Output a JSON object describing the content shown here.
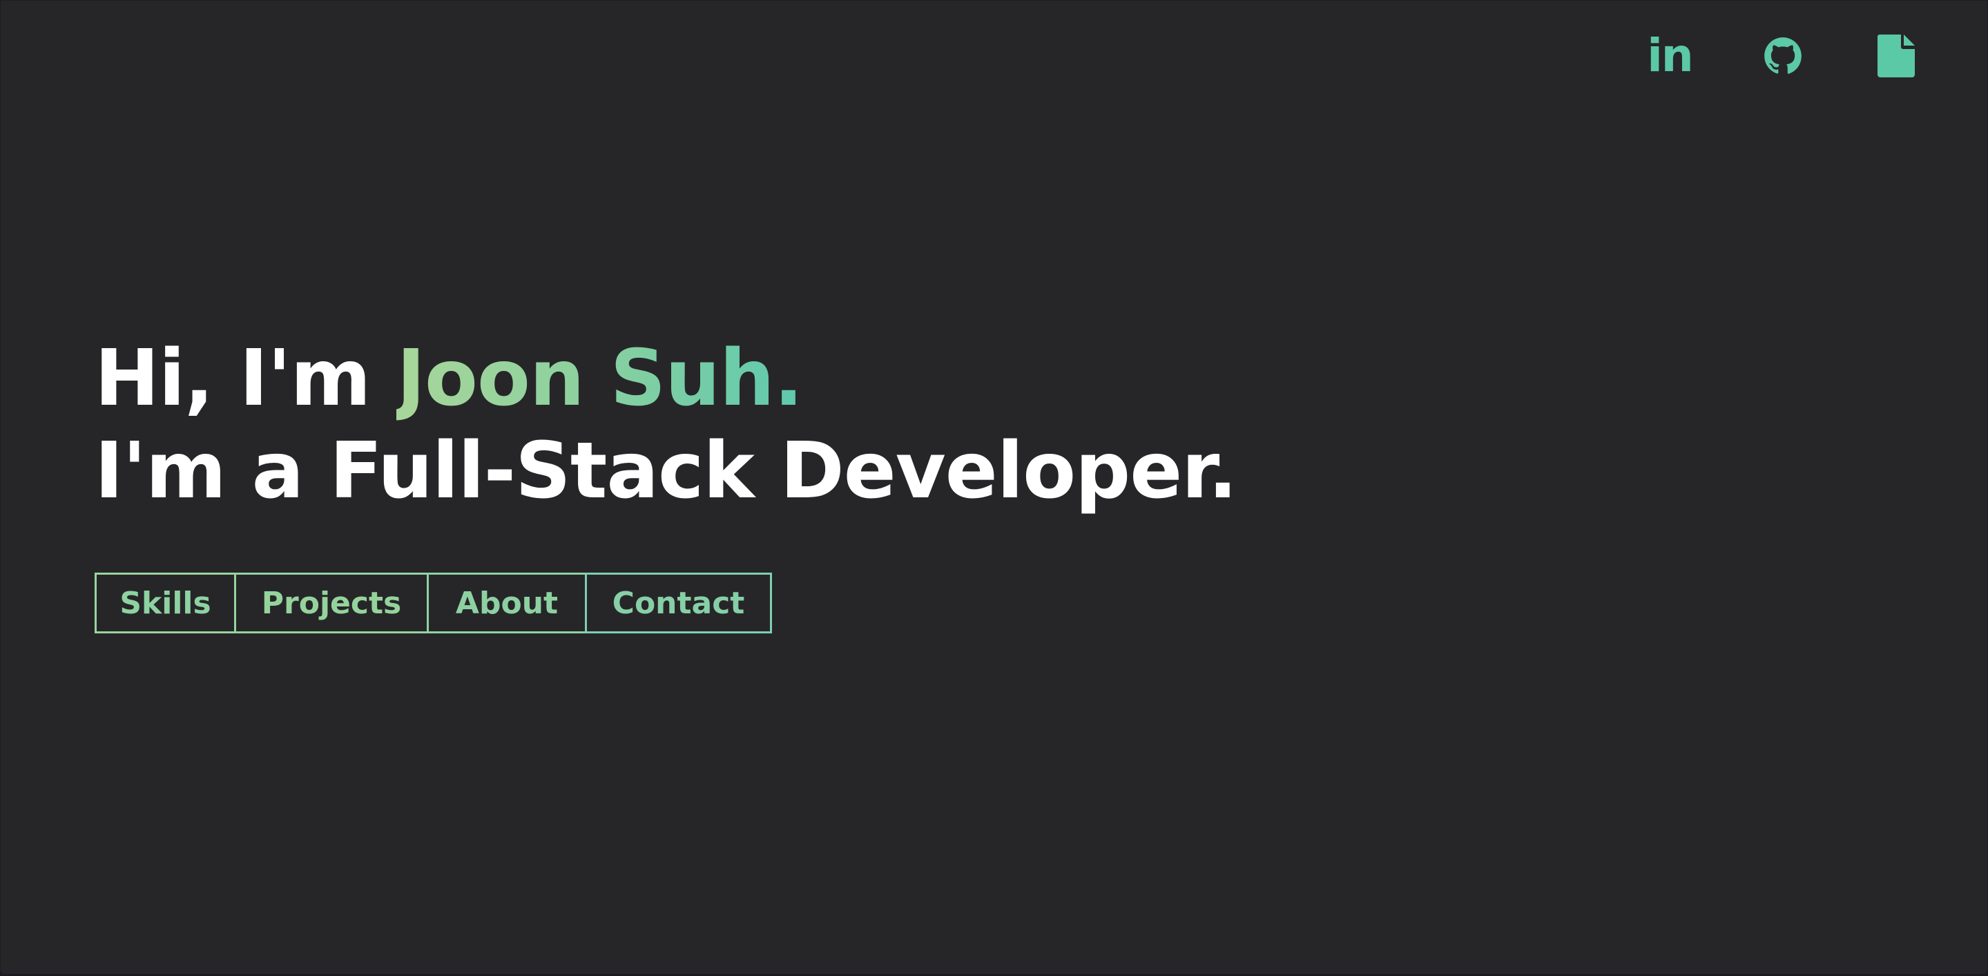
{
  "social": {
    "linkedin_label": "in",
    "icons": [
      "linkedin-icon",
      "github-icon",
      "resume-document-icon"
    ],
    "accent_color": "#5bc8a6"
  },
  "hero": {
    "greeting": "Hi, I'm ",
    "name": "Joon Suh.",
    "tagline": "I'm a Full-Stack Developer."
  },
  "nav": {
    "skills": "Skills",
    "projects": "Projects",
    "about": "About",
    "contact": "Contact"
  },
  "colors": {
    "background": "#262628",
    "headline": "#ffffff",
    "gradient_start": "#a8d69a",
    "gradient_end": "#5fc9ad"
  }
}
